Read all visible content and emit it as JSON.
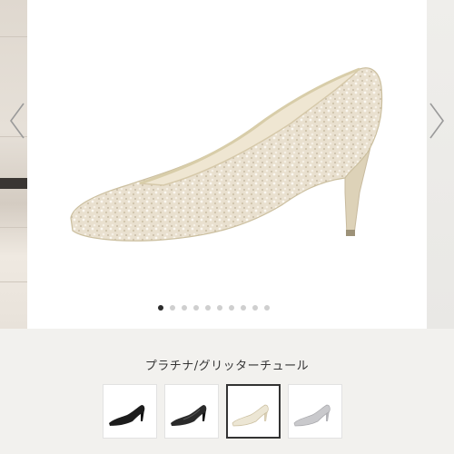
{
  "product": {
    "selected_color": "プラチナ/グリッターチュール",
    "main_image": "platinum-glitter-tulle-pump",
    "colors": [
      "#1c1c1c",
      "#2a2a2a",
      "#ece6d4",
      "#c9c9cc"
    ]
  },
  "carousel": {
    "slide_count": 10,
    "active_index": 0,
    "prev_icon": "chevron-left-icon",
    "next_icon": "chevron-right-icon"
  },
  "thumbnails": [
    {
      "name": "black-suede",
      "selected": false
    },
    {
      "name": "black-tulle",
      "selected": false
    },
    {
      "name": "platinum-glitter-tulle",
      "selected": true
    },
    {
      "name": "silver-glitter",
      "selected": false
    }
  ]
}
